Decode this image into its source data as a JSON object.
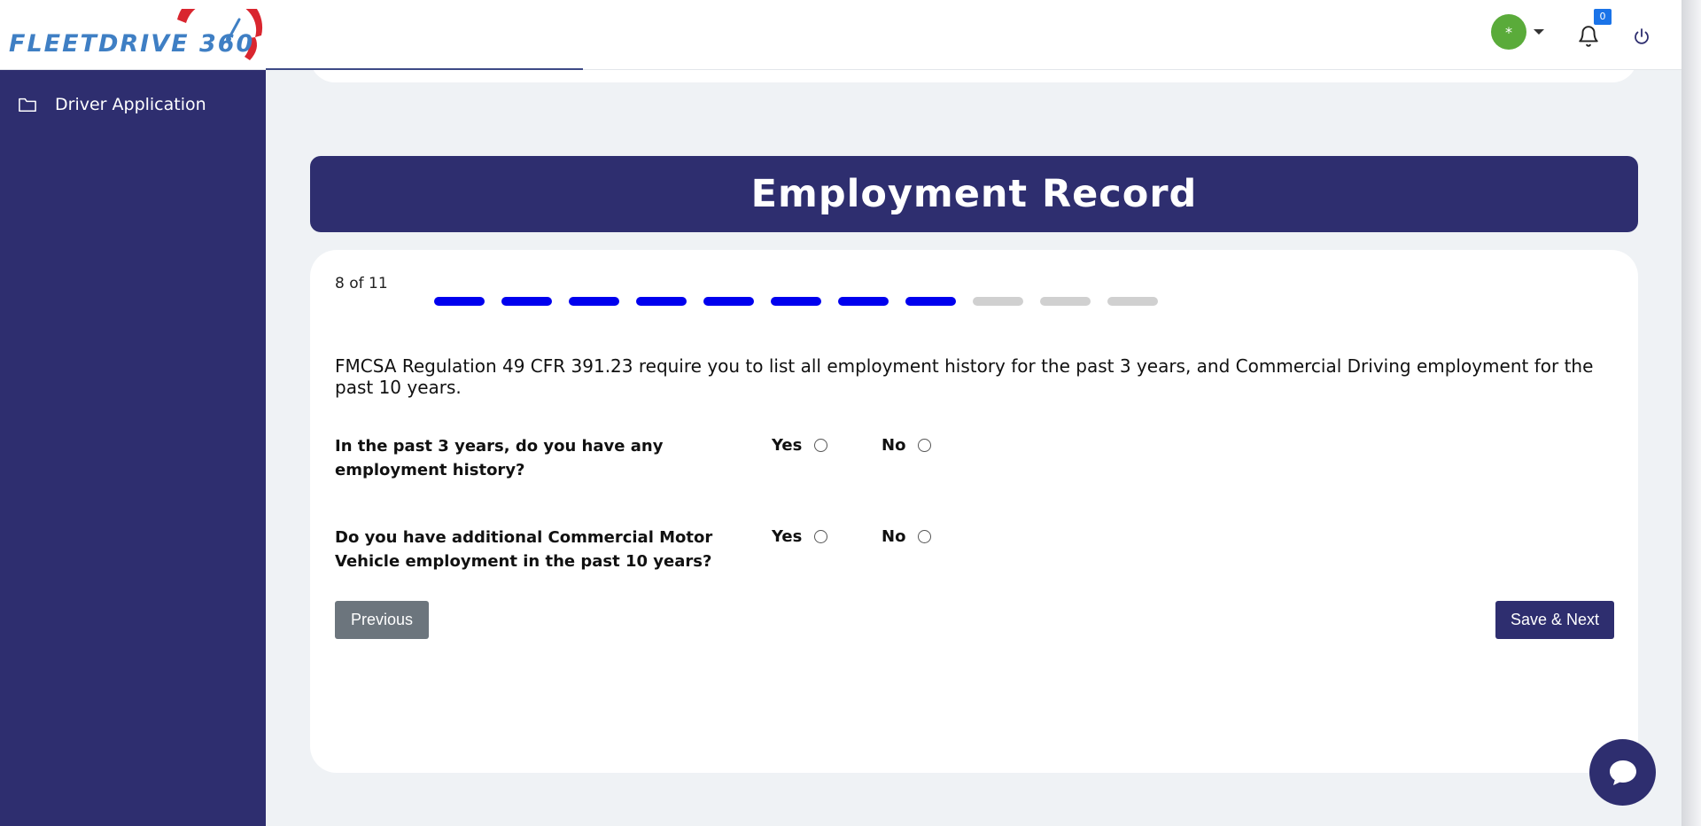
{
  "brand": {
    "logo_text": "FLEETDRIVE 360",
    "logo_blue": "#3f7fc4",
    "logo_red": "#d9262f"
  },
  "header": {
    "avatar_symbol": "*",
    "avatar_color": "#5aab3a",
    "notification_count": "0",
    "icons": [
      "chevron-down-icon",
      "bell-icon",
      "power-icon"
    ]
  },
  "sidebar": {
    "items": [
      {
        "label": "Driver Application",
        "icon": "folder-icon"
      }
    ]
  },
  "form": {
    "title": "Employment Record",
    "step_label": "8 of 11",
    "step_current": 8,
    "step_total": 11,
    "regulation_text": "FMCSA Regulation 49 CFR 391.23 require you to list all employment history for the past 3 years, and Commercial Driving employment for the past 10 years.",
    "questions": [
      {
        "text": "In the past 3 years, do you have any employment history?",
        "yes_label": "Yes",
        "no_label": "No",
        "selected": null
      },
      {
        "text": "Do you have additional Commercial Motor Vehicle employment in the past 10 years?",
        "yes_label": "Yes",
        "no_label": "No",
        "selected": null
      }
    ],
    "previous_label": "Previous",
    "next_label": "Save & Next"
  },
  "colors": {
    "primary": "#2e2e6f",
    "step_done": "#0000ee",
    "step_pending": "#d0d0d0",
    "secondary_button": "#6c757d",
    "badge": "#1a73e8"
  },
  "chat": {
    "icon": "chat-bubble-icon"
  }
}
